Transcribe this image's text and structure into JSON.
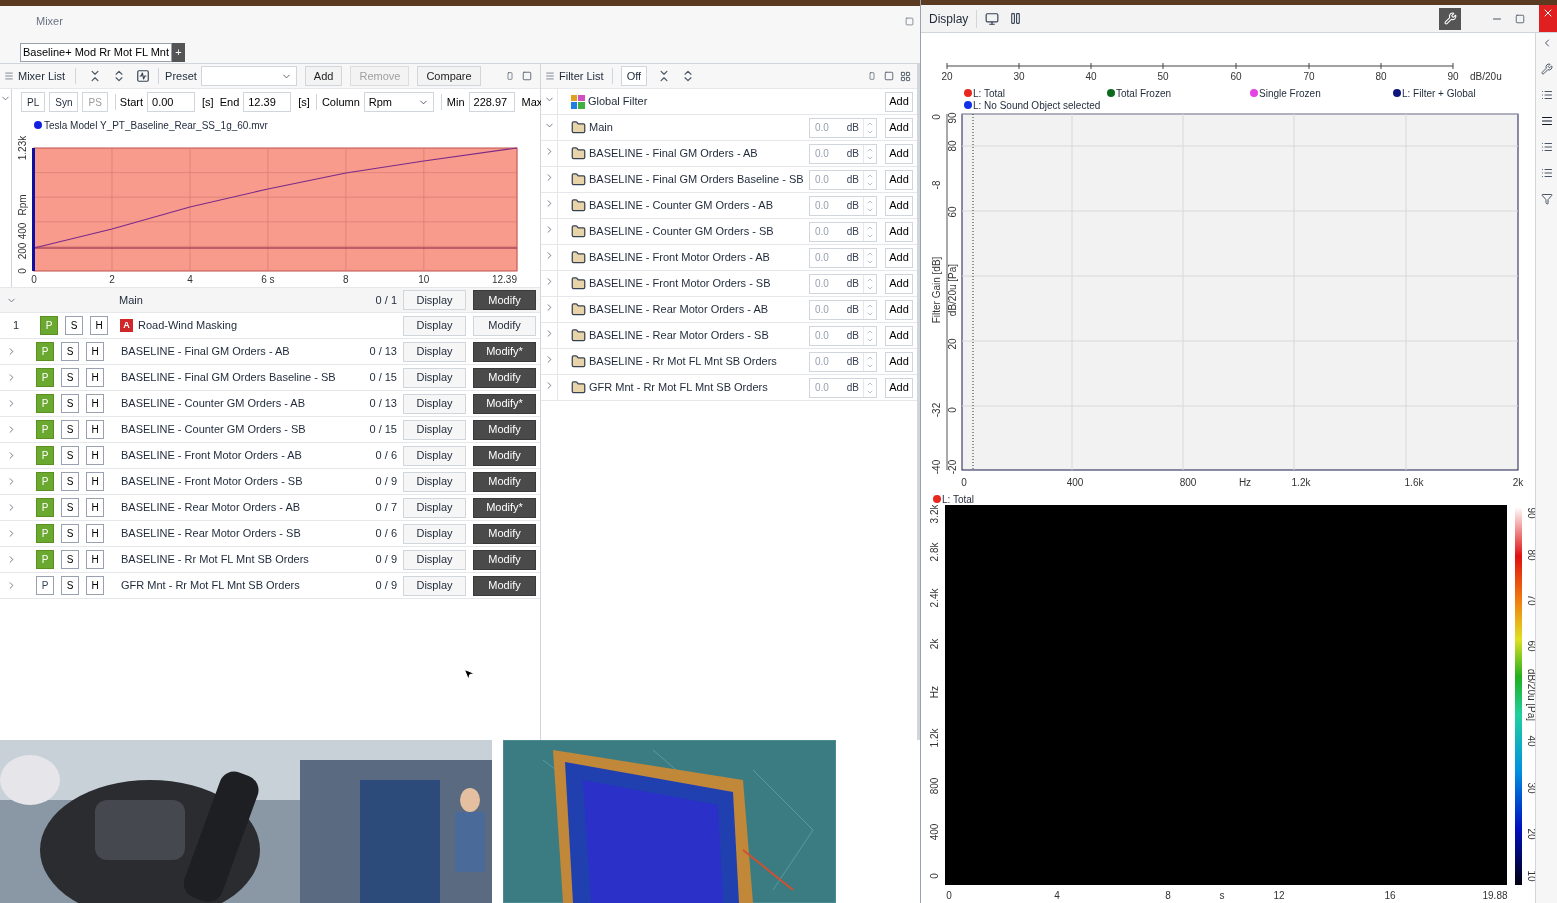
{
  "mixer": {
    "title": "Mixer",
    "tabs": [
      {
        "label": "Baseline+ Mod Rr Mot FL Mnt",
        "selected": true
      }
    ],
    "add_tab": "+",
    "toolbar": {
      "title": "Mixer List",
      "preset_label": "Preset",
      "buttons": [
        {
          "label": "Add",
          "disabled": false
        },
        {
          "label": "Remove",
          "disabled": true
        },
        {
          "label": "Compare",
          "disabled": false
        }
      ]
    },
    "range_bar": {
      "expanded": true,
      "toggles": [
        {
          "label": "PL",
          "disabled": false
        },
        {
          "label": "Syn",
          "disabled": false
        },
        {
          "label": "PS",
          "disabled": true
        }
      ],
      "start_label": "Start",
      "start": "0.00",
      "start_unit": "[s]",
      "end_label": "End",
      "end": "12.39",
      "end_unit": "[s]",
      "column_label": "Column",
      "column": "Rpm",
      "min_label": "Min",
      "min": "228.97",
      "max_label": "Max"
    },
    "chart": {
      "chart_data": {
        "type": "line",
        "ylabel": "Rpm",
        "x": [
          0,
          2,
          4,
          6,
          8,
          10,
          12.39
        ],
        "grid": true,
        "ref_lines": [
          {
            "axis": "y",
            "value": 230
          }
        ],
        "series": [
          {
            "name": "Tesla Model Y_PT_Baseline_Rear_SS_1g_60.mvr",
            "color": "#7a2a8a",
            "values": [
              230,
              420,
              640,
              820,
              980,
              1100,
              1230
            ]
          }
        ],
        "xlim": [
          0,
          12.39
        ],
        "ylim": [
          0,
          1230
        ],
        "xticks": [
          0,
          2,
          4,
          {
            "value": 6,
            "label": "6 s"
          },
          8,
          10,
          12.39
        ],
        "yticks": [
          0,
          200,
          400,
          {
            "value": 1230,
            "label": "1.23k"
          }
        ]
      }
    },
    "main_row": {
      "expanded": true,
      "name": "Main",
      "count": "0 / 1",
      "display": "Display",
      "modify": "Modify",
      "modify_active": true
    },
    "masking_row": {
      "index": "1",
      "p": "P",
      "p_on": true,
      "s": "S",
      "h": "H",
      "badge": "A",
      "name": "Road-Wind Masking",
      "display": "Display",
      "modify": "Modify",
      "modify_active": false
    },
    "rows": [
      {
        "expanded": false,
        "p": "P",
        "p_on": true,
        "s": "S",
        "h": "H",
        "name": "BASELINE - Final GM Orders - AB",
        "count": "0 / 13",
        "display": "Display",
        "modify": "Modify*",
        "modify_active": true
      },
      {
        "expanded": false,
        "p": "P",
        "p_on": true,
        "s": "S",
        "h": "H",
        "name": "BASELINE - Final GM Orders Baseline - SB",
        "count": "0 / 15",
        "display": "Display",
        "modify": "Modify",
        "modify_active": true
      },
      {
        "expanded": false,
        "p": "P",
        "p_on": true,
        "s": "S",
        "h": "H",
        "name": "BASELINE - Counter GM Orders - AB",
        "count": "0 / 13",
        "display": "Display",
        "modify": "Modify*",
        "modify_active": true
      },
      {
        "expanded": false,
        "p": "P",
        "p_on": true,
        "s": "S",
        "h": "H",
        "name": "BASELINE - Counter GM Orders - SB",
        "count": "0 / 15",
        "display": "Display",
        "modify": "Modify",
        "modify_active": true
      },
      {
        "expanded": false,
        "p": "P",
        "p_on": true,
        "s": "S",
        "h": "H",
        "name": "BASELINE - Front Motor Orders - AB",
        "count": "0 / 6",
        "display": "Display",
        "modify": "Modify",
        "modify_active": true
      },
      {
        "expanded": false,
        "p": "P",
        "p_on": true,
        "s": "S",
        "h": "H",
        "name": "BASELINE - Front Motor Orders - SB",
        "count": "0 / 9",
        "display": "Display",
        "modify": "Modify",
        "modify_active": true
      },
      {
        "expanded": false,
        "p": "P",
        "p_on": true,
        "s": "S",
        "h": "H",
        "name": "BASELINE - Rear Motor Orders - AB",
        "count": "0 / 7",
        "display": "Display",
        "modify": "Modify*",
        "modify_active": true
      },
      {
        "expanded": false,
        "p": "P",
        "p_on": true,
        "s": "S",
        "h": "H",
        "name": "BASELINE - Rear Motor Orders - SB",
        "count": "0 / 6",
        "display": "Display",
        "modify": "Modify",
        "modify_active": true
      },
      {
        "expanded": false,
        "p": "P",
        "p_on": true,
        "s": "S",
        "h": "H",
        "name": "BASELINE - Rr Mot FL Mnt SB Orders",
        "count": "0 / 9",
        "display": "Display",
        "modify": "Modify",
        "modify_active": true
      },
      {
        "expanded": false,
        "p": "P",
        "p_on": false,
        "s": "S",
        "h": "H",
        "name": "GFR Mnt - Rr Mot FL Mnt SB Orders",
        "count": "0 / 9",
        "display": "Display",
        "modify": "Modify",
        "modify_active": true
      }
    ]
  },
  "filter_list": {
    "title": "Filter List",
    "off": "Off",
    "global": {
      "expanded": true,
      "name": "Global Filter",
      "add": "Add"
    },
    "rows": [
      {
        "expanded": true,
        "name": "Main",
        "gain": "0.0",
        "unit": "dB",
        "add": "Add"
      },
      {
        "expanded": false,
        "name": "BASELINE - Final GM Orders - AB",
        "gain": "0.0",
        "unit": "dB",
        "add": "Add"
      },
      {
        "expanded": false,
        "name": "BASELINE - Final GM Orders Baseline - SB",
        "gain": "0.0",
        "unit": "dB",
        "add": "Add"
      },
      {
        "expanded": false,
        "name": "BASELINE - Counter GM Orders - AB",
        "gain": "0.0",
        "unit": "dB",
        "add": "Add"
      },
      {
        "expanded": false,
        "name": "BASELINE - Counter GM Orders - SB",
        "gain": "0.0",
        "unit": "dB",
        "add": "Add"
      },
      {
        "expanded": false,
        "name": "BASELINE - Front Motor Orders - AB",
        "gain": "0.0",
        "unit": "dB",
        "add": "Add"
      },
      {
        "expanded": false,
        "name": "BASELINE - Front Motor Orders - SB",
        "gain": "0.0",
        "unit": "dB",
        "add": "Add"
      },
      {
        "expanded": false,
        "name": "BASELINE - Rear Motor Orders - AB",
        "gain": "0.0",
        "unit": "dB",
        "add": "Add"
      },
      {
        "expanded": false,
        "name": "BASELINE - Rear Motor Orders - SB",
        "gain": "0.0",
        "unit": "dB",
        "add": "Add"
      },
      {
        "expanded": false,
        "name": "BASELINE - Rr Mot FL Mnt SB Orders",
        "gain": "0.0",
        "unit": "dB",
        "add": "Add"
      },
      {
        "expanded": false,
        "name": "GFR Mnt - Rr Mot FL Mnt SB Orders",
        "gain": "0.0",
        "unit": "dB",
        "add": "Add"
      }
    ]
  },
  "display": {
    "title": "Display",
    "level_axis": {
      "ticks": [
        "20",
        "30",
        "40",
        "50",
        "60",
        "70",
        "80",
        "90"
      ],
      "unit": "dB/20u"
    },
    "legend": [
      {
        "label": "L: Total",
        "color": "#e8281c"
      },
      {
        "label": "Total Frozen",
        "color": "#0b6a1c"
      },
      {
        "label": "Single Frozen",
        "color": "#e444e4"
      },
      {
        "label": "L: Filter + Global",
        "color": "#10157c"
      },
      {
        "label": "L: No Sound Object selected",
        "color": "#1030e8"
      }
    ],
    "spectrum": {
      "gain_label": "Filter Gain [dB]",
      "gain_ticks": [
        "0",
        "-8",
        "-32",
        "-40"
      ],
      "level_label": "dB/20u [Pa]",
      "level_ticks": [
        "90",
        "80",
        "60",
        "20",
        "0",
        "-20"
      ],
      "x_ticks": [
        "0",
        "400",
        "800",
        "Hz",
        "1.2k",
        "1.6k",
        "2k"
      ]
    },
    "spectrogram": {
      "legend": {
        "label": "L: Total",
        "color": "#e8281c"
      },
      "y_ticks": [
        "3.2k",
        "2.8k",
        "2.4k",
        "2k",
        "Hz",
        "1.2k",
        "800",
        "400",
        "0"
      ],
      "x_ticks": [
        "0",
        "4",
        "8",
        "s",
        "12",
        "16",
        "19.88"
      ],
      "scale_ticks": [
        "90",
        "80",
        "70",
        "60",
        "dB/20u [Pa]",
        "40",
        "30",
        "20",
        "10"
      ]
    }
  }
}
